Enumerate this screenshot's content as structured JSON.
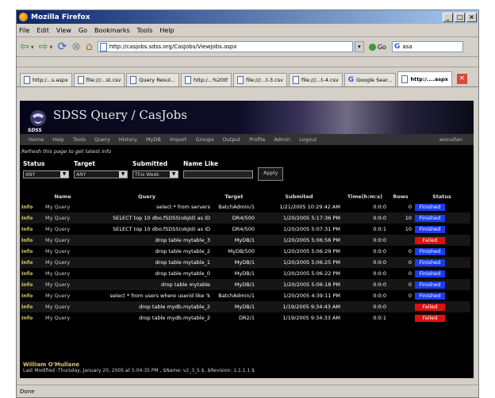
{
  "window": {
    "title": "Mozilla Firefox",
    "min": "_",
    "max": "□",
    "close": "×"
  },
  "menu": [
    "File",
    "Edit",
    "View",
    "Go",
    "Bookmarks",
    "Tools",
    "Help"
  ],
  "nav": {
    "url": "http://casjobs.sdss.org/CasJobs/ViewJobs.aspx",
    "go_label": "Go",
    "search_value": "asa"
  },
  "tabs": [
    "http:/...s.aspx",
    "file:///...st.csv",
    "Query Resul...",
    "http:/...%20tf",
    "file:///...t-3.csv",
    "file:///...t-4.csv",
    "Google Sear...",
    "http:/....aspx"
  ],
  "site": {
    "title": "SDSS Query / CasJobs",
    "logo_text": "SDSS",
    "menu": [
      "Home",
      "Help",
      "Tools",
      "Query",
      "History",
      "MyDB",
      "Import",
      "Groups",
      "Output",
      "Profile",
      "Admin",
      "Logout"
    ],
    "user": "wonullan",
    "refresh_text": "Refresh this page to get latest info"
  },
  "filters": {
    "status_label": "Status",
    "status_value": "ANY",
    "target_label": "Target",
    "target_value": "ANY",
    "submitted_label": "Submitted",
    "submitted_value": "This Week",
    "namelike_label": "Name Like",
    "apply_label": "Apply"
  },
  "table": {
    "headers": [
      "",
      "Name",
      "Query",
      "Target",
      "Submited",
      "Time(h:m:s)",
      "Rows",
      "Status"
    ],
    "rows": [
      {
        "info": "Info",
        "name": "My Query",
        "query": "select * from servers",
        "target": "BatchAdmin/1",
        "submitted": "1/21/2005 10:29:42 AM",
        "time": "0:0:0",
        "rows": "0",
        "status": "Finished"
      },
      {
        "info": "Info",
        "name": "My Query",
        "query": "SELECT top 10 dbo.fSDSS(objId) as ID",
        "target": "DR4/500",
        "submitted": "1/20/2005 5:17:36 PM",
        "time": "0:0:0",
        "rows": "10",
        "status": "Finished"
      },
      {
        "info": "Info",
        "name": "My Query",
        "query": "SELECT top 10 dbo.fSDSS(objId) as ID",
        "target": "DR4/500",
        "submitted": "1/20/2005 5:07:31 PM",
        "time": "0:0:1",
        "rows": "10",
        "status": "Finished"
      },
      {
        "info": "Info",
        "name": "My Query",
        "query": "drop table mytable_3",
        "target": "MyDB/1",
        "submitted": "1/20/2005 5:06:56 PM",
        "time": "0:0:0",
        "rows": "",
        "status": "Failed"
      },
      {
        "info": "Info",
        "name": "My Query",
        "query": "drop table mytable_2",
        "target": "MyDB/500",
        "submitted": "1/20/2005 5:06:29 PM",
        "time": "0:0:0",
        "rows": "0",
        "status": "Finished"
      },
      {
        "info": "Info",
        "name": "My Query",
        "query": "drop table mytable_1",
        "target": "MyDB/1",
        "submitted": "1/20/2005 5:06:25 PM",
        "time": "0:0:0",
        "rows": "0",
        "status": "Finished"
      },
      {
        "info": "Info",
        "name": "My Query",
        "query": "drop table mytable_0",
        "target": "MyDB/1",
        "submitted": "1/20/2005 5:06:22 PM",
        "time": "0:0:0",
        "rows": "0",
        "status": "Finished"
      },
      {
        "info": "Info",
        "name": "My Query",
        "query": "drop table mytable",
        "target": "MyDB/1",
        "submitted": "1/20/2005 5:06:18 PM",
        "time": "0:0:0",
        "rows": "0",
        "status": "Finished"
      },
      {
        "info": "Info",
        "name": "My Query",
        "query": "select * from users where userid like 'k",
        "target": "BatchAdmin/1",
        "submitted": "1/20/2005 4:39:11 PM",
        "time": "0:0:0",
        "rows": "0",
        "status": "Finished"
      },
      {
        "info": "Info",
        "name": "My Query",
        "query": "drop table mydb.mytable_2",
        "target": "MyDB/1",
        "submitted": "1/19/2005 9:34:43 AM",
        "time": "0:0:0",
        "rows": "",
        "status": "Failed"
      },
      {
        "info": "Info",
        "name": "My Query",
        "query": "drop table mydb.mytable_2",
        "target": "DR2/1",
        "submitted": "1/19/2005 9:34:33 AM",
        "time": "0:0:1",
        "rows": "",
        "status": "Failed"
      }
    ]
  },
  "footer": {
    "author": "William O'Mullane",
    "modified": "Last Modified :Thursday, January 20, 2005 at 5:04:35 PM , $Name: v2_3_5 $, $Revision: 1.1.1.1 $"
  },
  "statusbar": "Done",
  "colors": {
    "finished": "#1a3cf0",
    "failed": "#e01010"
  }
}
